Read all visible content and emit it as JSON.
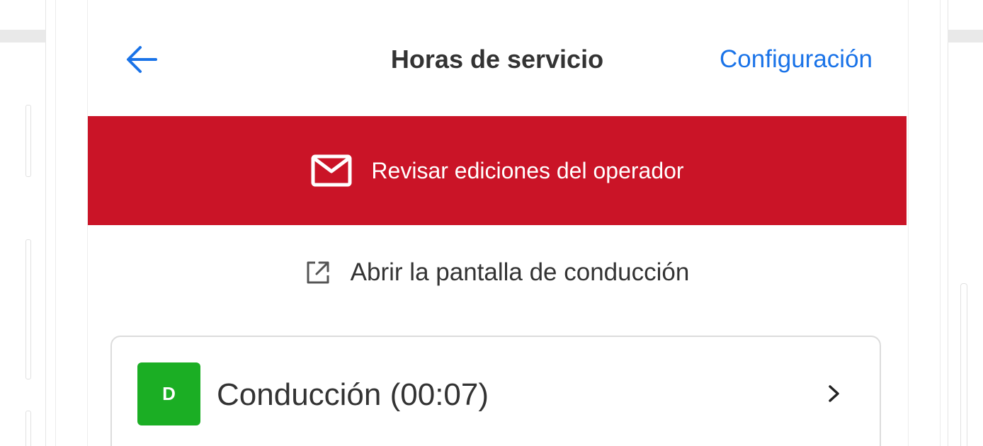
{
  "header": {
    "title": "Horas de servicio",
    "settings_label": "Configuración",
    "back_icon": "arrow-left-icon"
  },
  "banner": {
    "label": "Revisar ediciones del operador",
    "icon": "envelope-icon",
    "background_color": "#ca1427"
  },
  "open_driving_screen": {
    "label": "Abrir la pantalla de conducción",
    "icon": "external-link-icon"
  },
  "duty_status": {
    "badge": "D",
    "label": "Conducción (00:07)",
    "badge_color": "#1bae24",
    "icon": "chevron-right-icon"
  },
  "colors": {
    "accent": "#1a73e8",
    "text": "#333333"
  }
}
